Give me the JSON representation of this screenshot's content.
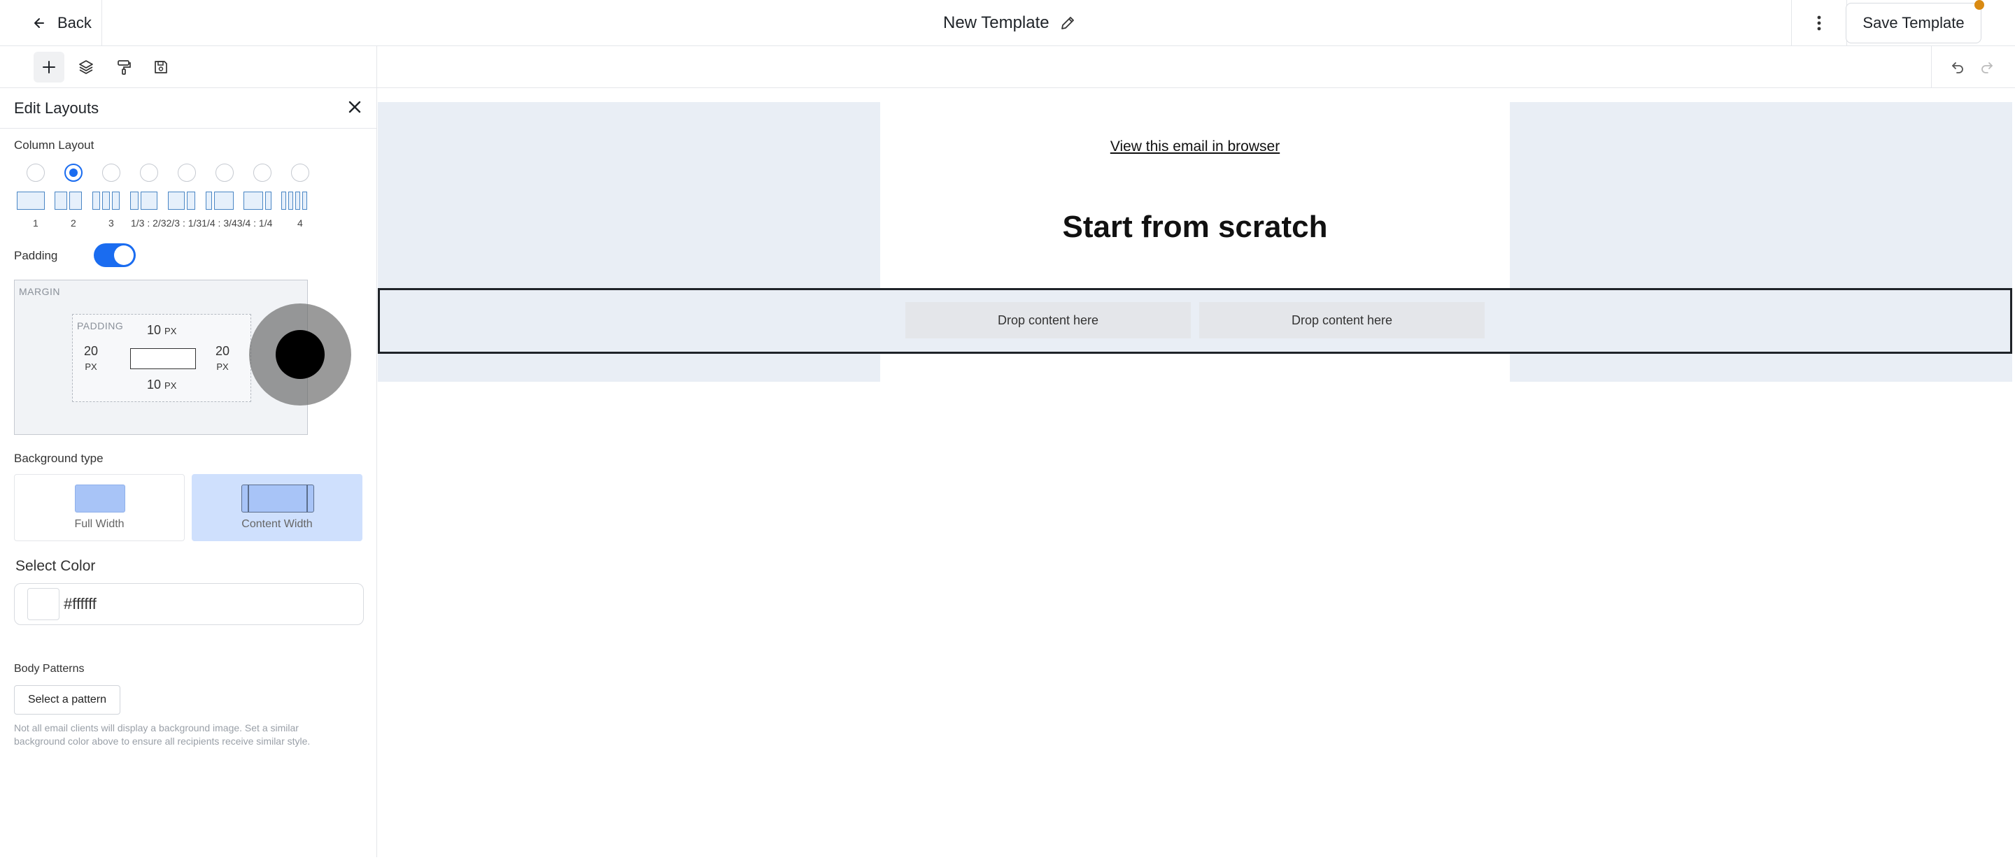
{
  "header": {
    "back_label": "Back",
    "title": "New Template",
    "save_label": "Save Template",
    "accent": "#d98a12"
  },
  "toolbar": {
    "tools": [
      "plus-icon",
      "layers-icon",
      "paint-roller-icon",
      "save-icon"
    ]
  },
  "panel": {
    "title": "Edit Layouts",
    "column_layout_label": "Column Layout",
    "layouts": [
      {
        "label": "1",
        "selected": false
      },
      {
        "label": "2",
        "selected": true
      },
      {
        "label": "3",
        "selected": false
      },
      {
        "label": "1/3 : 2/3",
        "selected": false
      },
      {
        "label": "2/3 : 1/3",
        "selected": false
      },
      {
        "label": "1/4 : 3/4",
        "selected": false
      },
      {
        "label": "3/4 : 1/4",
        "selected": false
      },
      {
        "label": "4",
        "selected": false
      }
    ],
    "layout_numbers_line": "1/3 : 2/32/3 : 1/31/4 : 3/43/4 : 1/4",
    "padding_label": "Padding",
    "padding_enabled": true,
    "box": {
      "margin_label": "MARGIN",
      "padding_label": "PADDING",
      "top": "10",
      "bottom": "10",
      "left": "20",
      "right": "20",
      "unit": "PX"
    },
    "background_type_label": "Background type",
    "bg_options": {
      "full": "Full Width",
      "content": "Content Width"
    },
    "bg_selected": "Content Width",
    "select_color_label": "Select Color",
    "color_value": "#ffffff",
    "body_patterns_label": "Body Patterns",
    "select_pattern_label": "Select a pattern",
    "hint": "Not all email clients will display a background image. Set a similar background color above to ensure all recipients receive similar style."
  },
  "canvas": {
    "view_link": "View this email in browser",
    "heading": "Start from scratch",
    "drop_left": "Drop content here",
    "drop_right": "Drop content here"
  },
  "colors": {
    "primary": "#1a6cf0",
    "canvas_bg": "#e9eef5"
  }
}
